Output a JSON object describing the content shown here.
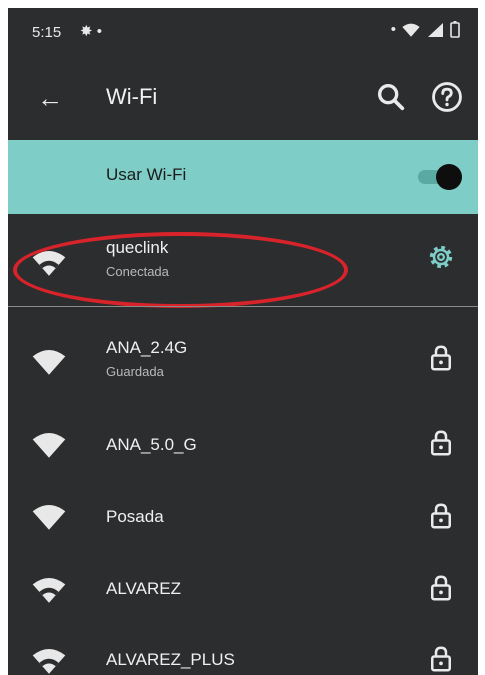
{
  "status_bar": {
    "time": "5:15"
  },
  "app_bar": {
    "title": "Wi-Fi"
  },
  "wifi_toggle": {
    "label": "Usar Wi-Fi",
    "enabled": true
  },
  "connected_network": {
    "name": "queclink",
    "status": "Conectada"
  },
  "networks": [
    {
      "name": "ANA_2.4G",
      "status": "Guardada",
      "secured": true
    },
    {
      "name": "ANA_5.0_G",
      "status": "",
      "secured": true
    },
    {
      "name": "Posada",
      "status": "",
      "secured": true
    },
    {
      "name": "ALVAREZ",
      "status": "",
      "secured": true
    },
    {
      "name": "ALVAREZ_PLUS",
      "status": "",
      "secured": true
    }
  ],
  "colors": {
    "background": "#2b2d2f",
    "toggle_bar": "#7ecdc6",
    "accent": "#7ecdc6",
    "annotation": "#d8232a"
  },
  "icons": {
    "back": "arrow-back-icon",
    "search": "search-icon",
    "help": "help-icon",
    "wifi": "wifi-icon",
    "settings": "gear-icon",
    "lock": "lock-icon"
  }
}
